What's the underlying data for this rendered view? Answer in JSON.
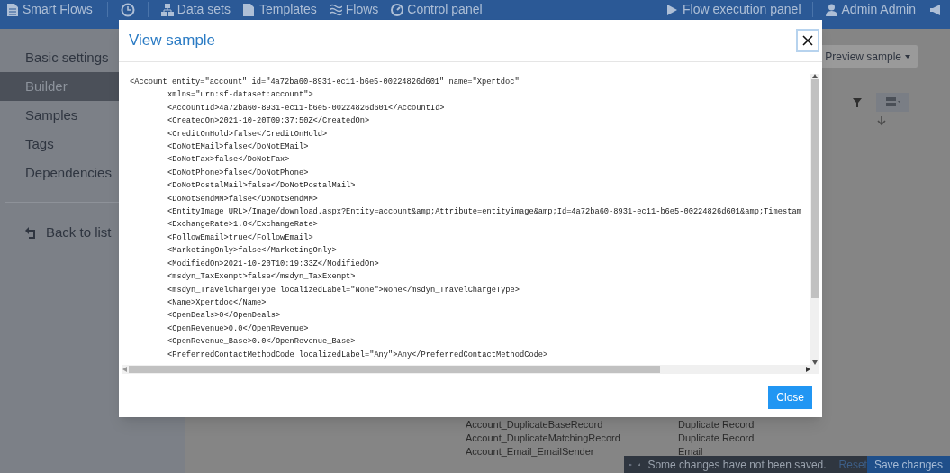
{
  "topbar": {
    "brand": "Smart Flows",
    "nav": [
      {
        "label": "Data sets",
        "kind": "datasets"
      },
      {
        "label": "Templates",
        "kind": "templates"
      },
      {
        "label": "Flows",
        "kind": "flows"
      },
      {
        "label": "Control panel",
        "kind": "control"
      }
    ],
    "execution": "Flow execution panel",
    "user": "Admin Admin"
  },
  "sidebar": {
    "items": [
      {
        "label": "Basic settings",
        "selected": false
      },
      {
        "label": "Builder",
        "selected": true
      },
      {
        "label": "Samples",
        "selected": false
      },
      {
        "label": "Tags",
        "selected": false
      },
      {
        "label": "Dependencies",
        "selected": false
      }
    ],
    "back": "Back to list"
  },
  "toolbar": {
    "preview": "Preview sample"
  },
  "list": {
    "rows": [
      [
        "Account_DuplicateBaseRecord",
        "Duplicate Record"
      ],
      [
        "Account_DuplicateMatchingRecord",
        "Duplicate Record"
      ],
      [
        "Account_Email_EmailSender",
        "Email"
      ]
    ]
  },
  "status_bar": {
    "message": "Some changes have not been saved.",
    "reset": "Reset",
    "save": "Save changes"
  },
  "dialog": {
    "title": "View sample",
    "close_button": "Close",
    "code": [
      {
        "text": "<Account entity=\"account\" id=\"4a72ba60-8931-ec11-b6e5-00224826d601\" name=\"Xpertdoc\"",
        "children": [
          "xmlns=\"urn:sf-dataset:account\">",
          "<AccountId>4a72ba60-8931-ec11-b6e5-00224826d601</AccountId>",
          "<CreatedOn>2021-10-20T09:37:50Z</CreatedOn>",
          "<CreditOnHold>false</CreditOnHold>",
          "<DoNotEMail>false</DoNotEMail>",
          "<DoNotFax>false</DoNotFax>",
          "<DoNotPhone>false</DoNotPhone>",
          "<DoNotPostalMail>false</DoNotPostalMail>",
          "<DoNotSendMM>false</DoNotSendMM>",
          "<EntityImage_URL>/Image/download.aspx?Entity=account&amp;Attribute=entityimage&amp;Id=4a72ba60-8931-ec11-b6e5-00224826d601&amp;Timestam",
          "<ExchangeRate>1.0</ExchangeRate>",
          "<FollowEmail>true</FollowEmail>",
          "<MarketingOnly>false</MarketingOnly>",
          "<ModifiedOn>2021-10-20T10:19:33Z</ModifiedOn>",
          "<msdyn_TaxExempt>false</msdyn_TaxExempt>",
          "<msdyn_TravelChargeType localizedLabel=\"None\">None</msdyn_TravelChargeType>",
          "<Name>Xpertdoc</Name>",
          "<OpenDeals>0</OpenDeals>",
          "<OpenRevenue>0.0</OpenRevenue>",
          "<OpenRevenue_Base>0.0</OpenRevenue_Base>",
          "<PreferredContactMethodCode localizedLabel=\"Any\">Any</PreferredContactMethodCode>"
        ]
      }
    ]
  }
}
